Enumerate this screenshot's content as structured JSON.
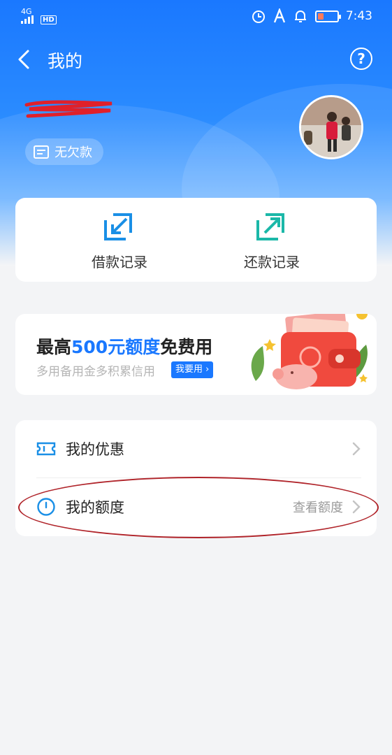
{
  "status_bar": {
    "network": "4G",
    "hd_label": "HD",
    "time": "7:43"
  },
  "nav": {
    "title": "我的",
    "back_icon": "chevron-left-icon",
    "help_icon": "question-circle-icon",
    "help_symbol": "?"
  },
  "profile": {
    "debt_status": "无欠款"
  },
  "records": {
    "items": [
      {
        "label": "借款记录",
        "icon": "borrow-record-icon"
      },
      {
        "label": "还款记录",
        "icon": "repay-record-icon"
      }
    ]
  },
  "promo": {
    "title_prefix": "最高",
    "title_highlight": "500元额度",
    "title_suffix": "免费用",
    "subtitle": "多用备用金多积累信用",
    "button_label": "我要用",
    "button_arrow": "›"
  },
  "menu": {
    "items": [
      {
        "label": "我的优惠",
        "value": "",
        "icon": "coupon-icon"
      },
      {
        "label": "我的额度",
        "value": "查看额度",
        "icon": "quota-icon"
      }
    ]
  },
  "colors": {
    "brand_blue": "#1a78ff",
    "annotation_red": "#b0242a"
  }
}
